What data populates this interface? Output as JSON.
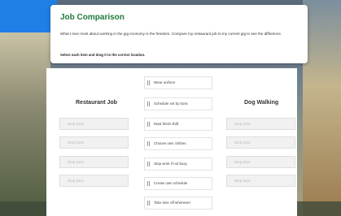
{
  "header": {
    "title": "Job Comparison",
    "description": "What I love most about working in the gig economy is the freedom. Compare my restaurant job to my current gig to see the difference.",
    "instruction": "Select each item and drag it to the correct location."
  },
  "columns": {
    "left_title": "Restaurant Job",
    "right_title": "Dog Walking",
    "drop_label": "Drop Zone"
  },
  "items": [
    "Wear uniform",
    "Schedule set by boss",
    "Must finish shift",
    "Choose own clothes",
    "Stop work if not busy",
    "Create own schedule",
    "Take time off whenever"
  ],
  "colors": {
    "accent": "#1f7a3c",
    "background_blue": "#1f7fe6"
  }
}
